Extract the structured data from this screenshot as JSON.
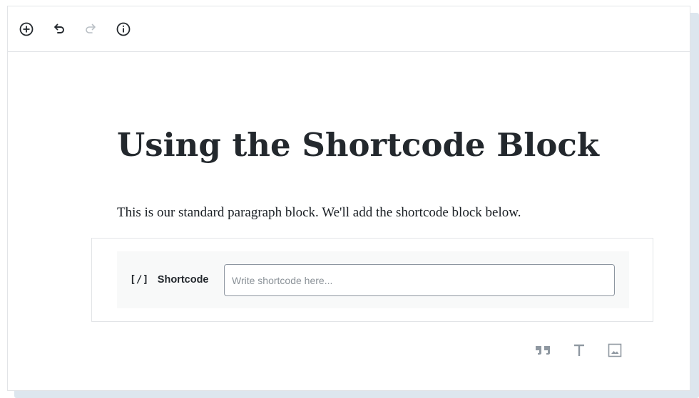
{
  "toolbar": {
    "items": [
      {
        "icon": "add-block-icon",
        "label": "Add block"
      },
      {
        "icon": "undo-icon",
        "label": "Undo"
      },
      {
        "icon": "redo-icon",
        "label": "Redo"
      },
      {
        "icon": "info-icon",
        "label": "Content structure"
      }
    ]
  },
  "post": {
    "title": "Using the Shortcode Block",
    "paragraph": "This is our standard paragraph block. We'll add the shortcode block below."
  },
  "shortcode_block": {
    "icon_text": "[/]",
    "label": "Shortcode",
    "input_value": "",
    "placeholder": "Write shortcode here..."
  },
  "quick_inserter": {
    "items": [
      {
        "icon": "quote-icon"
      },
      {
        "icon": "heading-icon"
      },
      {
        "icon": "image-icon"
      }
    ]
  },
  "colors": {
    "text_dark": "#23282d",
    "border": "#e2e4e7",
    "muted_icon": "#8f98a1",
    "block_bg": "#f8f9f9"
  }
}
